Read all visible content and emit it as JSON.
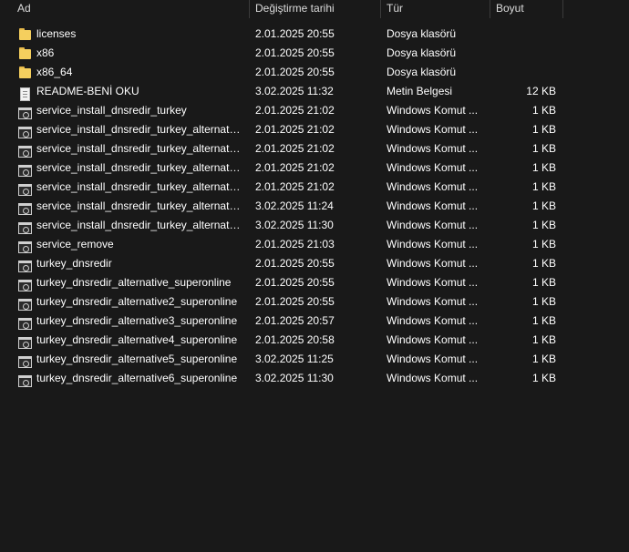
{
  "columns": {
    "name": "Ad",
    "date": "Değiştirme tarihi",
    "type": "Tür",
    "size": "Boyut"
  },
  "files": [
    {
      "name": "licenses",
      "date": "2.01.2025 20:55",
      "type": "Dosya klasörü",
      "size": "",
      "icon": "folder-icon"
    },
    {
      "name": "x86",
      "date": "2.01.2025 20:55",
      "type": "Dosya klasörü",
      "size": "",
      "icon": "folder-icon"
    },
    {
      "name": "x86_64",
      "date": "2.01.2025 20:55",
      "type": "Dosya klasörü",
      "size": "",
      "icon": "folder-icon"
    },
    {
      "name": "README-BENİ OKU",
      "date": "3.02.2025 11:32",
      "type": "Metin Belgesi",
      "size": "12 KB",
      "icon": "text-document-icon"
    },
    {
      "name": "service_install_dnsredir_turkey",
      "date": "2.01.2025 21:02",
      "type": "Windows Komut ...",
      "size": "1 KB",
      "icon": "batch-file-icon"
    },
    {
      "name": "service_install_dnsredir_turkey_alternativ...",
      "date": "2.01.2025 21:02",
      "type": "Windows Komut ...",
      "size": "1 KB",
      "icon": "batch-file-icon"
    },
    {
      "name": "service_install_dnsredir_turkey_alternativ...",
      "date": "2.01.2025 21:02",
      "type": "Windows Komut ...",
      "size": "1 KB",
      "icon": "batch-file-icon"
    },
    {
      "name": "service_install_dnsredir_turkey_alternativ...",
      "date": "2.01.2025 21:02",
      "type": "Windows Komut ...",
      "size": "1 KB",
      "icon": "batch-file-icon"
    },
    {
      "name": "service_install_dnsredir_turkey_alternativ...",
      "date": "2.01.2025 21:02",
      "type": "Windows Komut ...",
      "size": "1 KB",
      "icon": "batch-file-icon"
    },
    {
      "name": "service_install_dnsredir_turkey_alternativ...",
      "date": "3.02.2025 11:24",
      "type": "Windows Komut ...",
      "size": "1 KB",
      "icon": "batch-file-icon"
    },
    {
      "name": "service_install_dnsredir_turkey_alternativ...",
      "date": "3.02.2025 11:30",
      "type": "Windows Komut ...",
      "size": "1 KB",
      "icon": "batch-file-icon"
    },
    {
      "name": "service_remove",
      "date": "2.01.2025 21:03",
      "type": "Windows Komut ...",
      "size": "1 KB",
      "icon": "batch-file-icon"
    },
    {
      "name": "turkey_dnsredir",
      "date": "2.01.2025 20:55",
      "type": "Windows Komut ...",
      "size": "1 KB",
      "icon": "batch-file-icon"
    },
    {
      "name": "turkey_dnsredir_alternative_superonline",
      "date": "2.01.2025 20:55",
      "type": "Windows Komut ...",
      "size": "1 KB",
      "icon": "batch-file-icon"
    },
    {
      "name": "turkey_dnsredir_alternative2_superonline",
      "date": "2.01.2025 20:55",
      "type": "Windows Komut ...",
      "size": "1 KB",
      "icon": "batch-file-icon"
    },
    {
      "name": "turkey_dnsredir_alternative3_superonline",
      "date": "2.01.2025 20:57",
      "type": "Windows Komut ...",
      "size": "1 KB",
      "icon": "batch-file-icon"
    },
    {
      "name": "turkey_dnsredir_alternative4_superonline",
      "date": "2.01.2025 20:58",
      "type": "Windows Komut ...",
      "size": "1 KB",
      "icon": "batch-file-icon"
    },
    {
      "name": "turkey_dnsredir_alternative5_superonline",
      "date": "3.02.2025 11:25",
      "type": "Windows Komut ...",
      "size": "1 KB",
      "icon": "batch-file-icon"
    },
    {
      "name": "turkey_dnsredir_alternative6_superonline",
      "date": "3.02.2025 11:30",
      "type": "Windows Komut ...",
      "size": "1 KB",
      "icon": "batch-file-icon"
    }
  ],
  "colors": {
    "background": "#191919",
    "text": "#ffffff",
    "header_text": "#dcdcdc",
    "folder": "#f5cf5e"
  }
}
